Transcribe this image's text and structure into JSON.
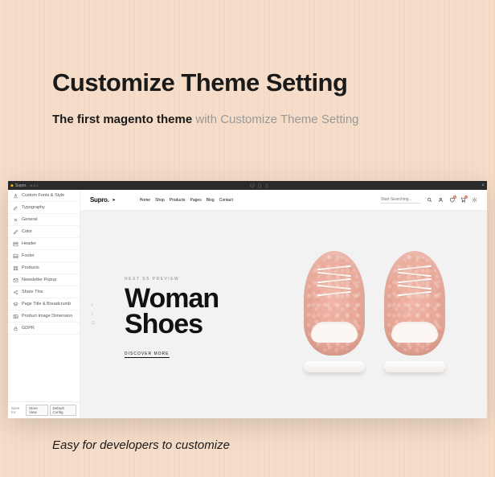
{
  "hero": {
    "title": "Customize Theme Setting",
    "sub_strong": "The first magento theme",
    "sub_rest": " with Customize Theme Setting",
    "footer": "Easy for developers to customize"
  },
  "window": {
    "title": "Supro.",
    "version": "v1.0.2",
    "save_label": "Save for:",
    "btn_store": "Store View",
    "btn_default": "Default Config"
  },
  "sidebar": {
    "items": [
      {
        "label": "Custom Fonts & Style"
      },
      {
        "label": "Typography"
      },
      {
        "label": "General"
      },
      {
        "label": "Color"
      },
      {
        "label": "Header"
      },
      {
        "label": "Footer"
      },
      {
        "label": "Products"
      },
      {
        "label": "Newsletter Popup"
      },
      {
        "label": "Share This"
      },
      {
        "label": "Page Title & Breadcrumb"
      },
      {
        "label": "Product Image Dimension"
      },
      {
        "label": "GDPR"
      }
    ]
  },
  "topbar": {
    "brand": "Supro.",
    "nav": [
      "Home",
      "Shop",
      "Products",
      "Pages",
      "Blog",
      "Contact"
    ],
    "search_placeholder": "Start Searching...",
    "wishlist_count": "0",
    "cart_count": "0"
  },
  "stage": {
    "eyebrow": "NEXT SS PREVIEW",
    "headline_l1": "Woman",
    "headline_l2": "Shoes",
    "cta": "DISCOVER MORE"
  }
}
